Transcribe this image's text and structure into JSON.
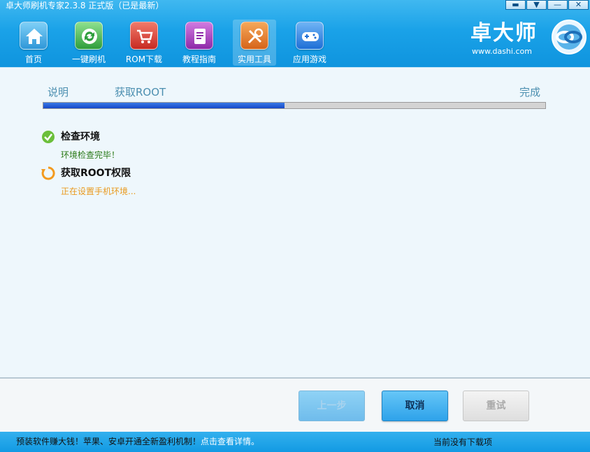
{
  "window": {
    "title": "卓大师刷机专家2.3.8 正式版（已是最新）",
    "controls": {
      "skin": "▬",
      "menu": "▼",
      "minimize": "—",
      "close": "✕"
    }
  },
  "nav": {
    "items": [
      {
        "label": "首页",
        "icon": "home-icon",
        "color": "#3aa3e0"
      },
      {
        "label": "一键刷机",
        "icon": "refresh-icon",
        "color": "#3bb24a"
      },
      {
        "label": "ROM下载",
        "icon": "cart-icon",
        "color": "#d9332b"
      },
      {
        "label": "教程指南",
        "icon": "book-icon",
        "color": "#a03ab8"
      },
      {
        "label": "实用工具",
        "icon": "tools-icon",
        "color": "#e07a1e"
      },
      {
        "label": "应用游戏",
        "icon": "gamepad-icon",
        "color": "#2a7fe0"
      }
    ],
    "active": "实用工具"
  },
  "brand": {
    "name": "卓大师",
    "url": "www.dashi.com"
  },
  "wizard": {
    "steps": [
      "说明",
      "获取ROOT",
      "完成"
    ],
    "progress": 0.48
  },
  "tasks": [
    {
      "title": "检查环境",
      "status_text": "环境检查完毕！",
      "state": "done",
      "icon": "check-circle-icon",
      "color": "#6bbf3a"
    },
    {
      "title": "获取ROOT权限",
      "status_text": "正在设置手机环境...",
      "state": "in-progress",
      "icon": "spinner-icon",
      "color": "#f39a1e"
    }
  ],
  "buttons": {
    "prev": "上一步",
    "cancel": "取消",
    "retry": "重试"
  },
  "statusbar": {
    "promo": "预装软件赚大钱！苹果、安卓开通全新盈利机制！",
    "promo_link": "点击查看详情。",
    "download_status": "当前没有下载项"
  }
}
